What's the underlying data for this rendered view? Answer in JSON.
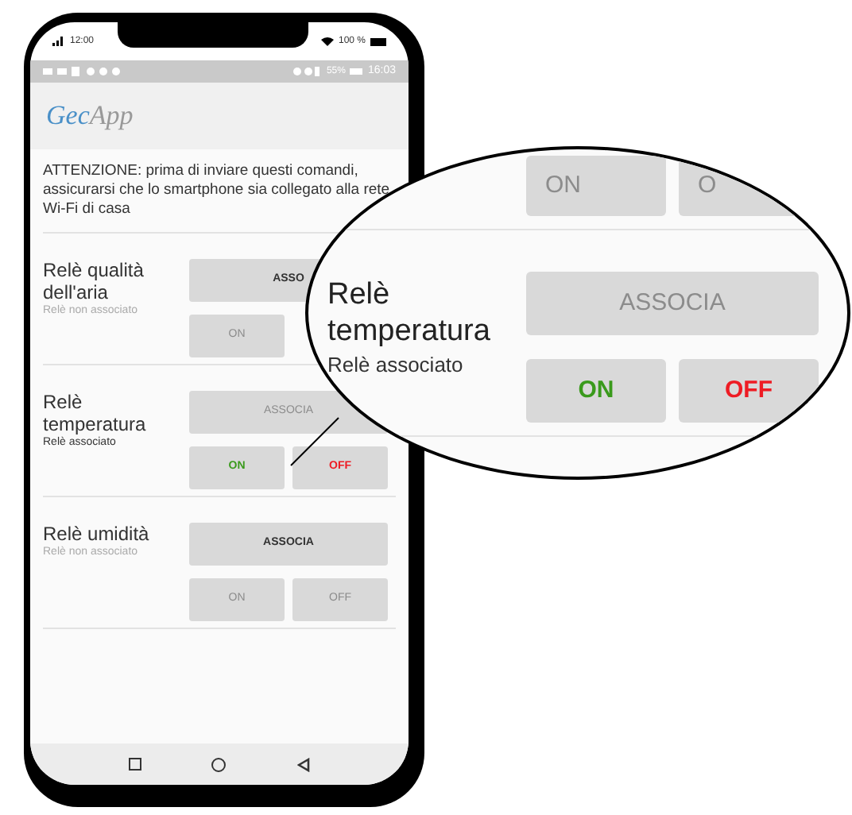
{
  "phone_status": {
    "time": "12:00",
    "battery": "100 %"
  },
  "android_status": {
    "battery": "55%",
    "time": "16:03"
  },
  "app_bar": {
    "logo_first": "Gec",
    "logo_second": "App"
  },
  "warning": "ATTENZIONE: prima di inviare questi comandi, assicurarsi che lo smartphone sia collegato alla rete Wi-Fi di casa",
  "relays": [
    {
      "name": "Relè qualità dell'aria",
      "status": "Relè non associato",
      "associated": false,
      "associate_label": "ASSO",
      "on_label": "ON"
    },
    {
      "name": "Relè temperatura",
      "status": "Relè associato",
      "associated": true,
      "associate_label": "ASSOCIA",
      "on_label": "ON",
      "off_label": "OFF"
    },
    {
      "name": "Relè umidità",
      "status": "Relè non associato",
      "associated": false,
      "associate_label": "ASSOCIA",
      "on_label": "ON",
      "off_label": "OFF"
    }
  ],
  "callout": {
    "top_buttons": [
      "ON",
      "O"
    ],
    "relay": {
      "name": "Relè temperatura",
      "status": "Relè associato",
      "associated": true,
      "associate_label": "ASSOCIA",
      "on_label": "ON",
      "off_label": "OFF"
    }
  }
}
